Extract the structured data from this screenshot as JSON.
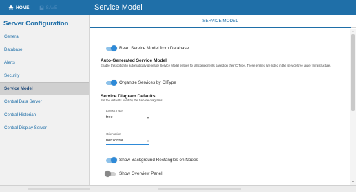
{
  "topbar": {
    "home_label": "HOME",
    "save_label": "SAVE",
    "page_title": "Service Model"
  },
  "sidebar": {
    "title": "Server Configuration",
    "items": [
      {
        "label": "General"
      },
      {
        "label": "Database"
      },
      {
        "label": "Alerts"
      },
      {
        "label": "Security"
      },
      {
        "label": "Service Model"
      },
      {
        "label": "Central Data Server"
      },
      {
        "label": "Central Historian"
      },
      {
        "label": "Central Display Server"
      }
    ],
    "active_index": 4
  },
  "tabs": [
    {
      "label": "SERVICE MODEL"
    }
  ],
  "content": {
    "read_from_db": {
      "label": "Read Service Model from Database",
      "on": true
    },
    "auto_generated": {
      "heading": "Auto-Generated Service Model",
      "description": "Enable this option to automatically generate Service Model entries for all components based on their CIType. These entries are listed in the service tree under Infrastructure."
    },
    "organize_by_citype": {
      "label": "Organize Services by CIType",
      "on": true
    },
    "diagram_defaults": {
      "heading": "Service Diagram Defaults",
      "description": "Set the defaults used by the Service diagrams."
    },
    "layout_type": {
      "label": "Layout Type",
      "value": "tree"
    },
    "orientation": {
      "label": "Orientation",
      "value": "horizontal"
    },
    "show_background": {
      "label": "Show Background Rectangles on Nodes",
      "on": true
    },
    "show_overview": {
      "label": "Show Overview Panel",
      "on": false
    }
  },
  "colors": {
    "brand": "#1f6fa8",
    "toggle_on": "#2e8ad8"
  },
  "icons": {
    "home": "home-icon",
    "save": "save-icon"
  }
}
